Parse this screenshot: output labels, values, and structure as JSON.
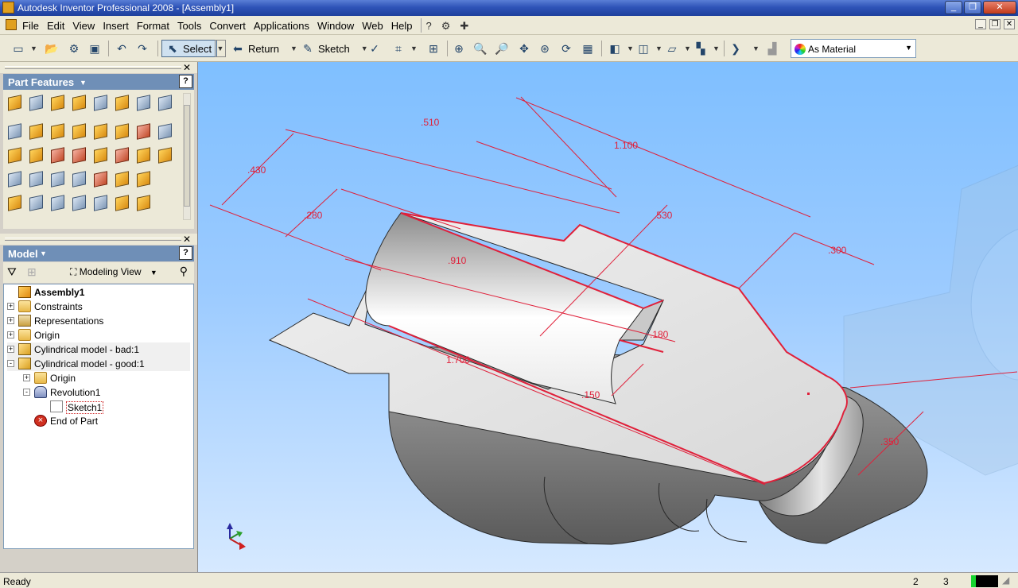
{
  "window": {
    "title": "Autodesk Inventor Professional 2008 - [Assembly1]"
  },
  "menu": {
    "items": [
      "File",
      "Edit",
      "View",
      "Insert",
      "Format",
      "Tools",
      "Convert",
      "Applications",
      "Window",
      "Web",
      "Help"
    ]
  },
  "toolbar": {
    "select_label": "Select",
    "return_label": "Return",
    "sketch_label": "Sketch",
    "material": "As Material"
  },
  "part_features": {
    "title": "Part Features"
  },
  "model": {
    "title": "Model",
    "view_label": "Modeling View",
    "tree": [
      {
        "label": "Assembly1",
        "type": "assy",
        "level": 0,
        "expander": "",
        "bold": true
      },
      {
        "label": "Constraints",
        "type": "folder",
        "level": 0,
        "expander": "+"
      },
      {
        "label": "Representations",
        "type": "rep",
        "level": 0,
        "expander": "+"
      },
      {
        "label": "Origin",
        "type": "folder",
        "level": 0,
        "expander": "+"
      },
      {
        "label": "Cylindrical model - bad:1",
        "type": "partbad",
        "level": 0,
        "expander": "+",
        "hl": true
      },
      {
        "label": "Cylindrical model - good:1",
        "type": "part",
        "level": 0,
        "expander": "-",
        "hl": true
      },
      {
        "label": "Origin",
        "type": "folder",
        "level": 1,
        "expander": "+"
      },
      {
        "label": "Revolution1",
        "type": "rev",
        "level": 1,
        "expander": "-"
      },
      {
        "label": "Sketch1",
        "type": "sketch",
        "level": 2,
        "expander": "",
        "sel": true
      },
      {
        "label": "End of Part",
        "type": "end",
        "level": 1,
        "expander": ""
      }
    ]
  },
  "dimensions": [
    {
      "id": "dim-510",
      "text": ".510"
    },
    {
      "id": "dim-1100",
      "text": "1.100"
    },
    {
      "id": "dim-430",
      "text": ".430"
    },
    {
      "id": "dim-280",
      "text": ".280"
    },
    {
      "id": "dim-530",
      "text": ".530"
    },
    {
      "id": "dim-910",
      "text": ".910"
    },
    {
      "id": "dim-300",
      "text": ".300"
    },
    {
      "id": "dim-180",
      "text": ".180"
    },
    {
      "id": "dim-1700",
      "text": "1.700"
    },
    {
      "id": "dim-150",
      "text": ".150"
    },
    {
      "id": "dim-350",
      "text": ".350"
    }
  ],
  "colors": {
    "dimension": "#e0203a",
    "viewport_top": "#7fbfff",
    "panel_header": "#6f8fb7"
  },
  "status": {
    "text": "Ready",
    "value1": "2",
    "value2": "3"
  }
}
